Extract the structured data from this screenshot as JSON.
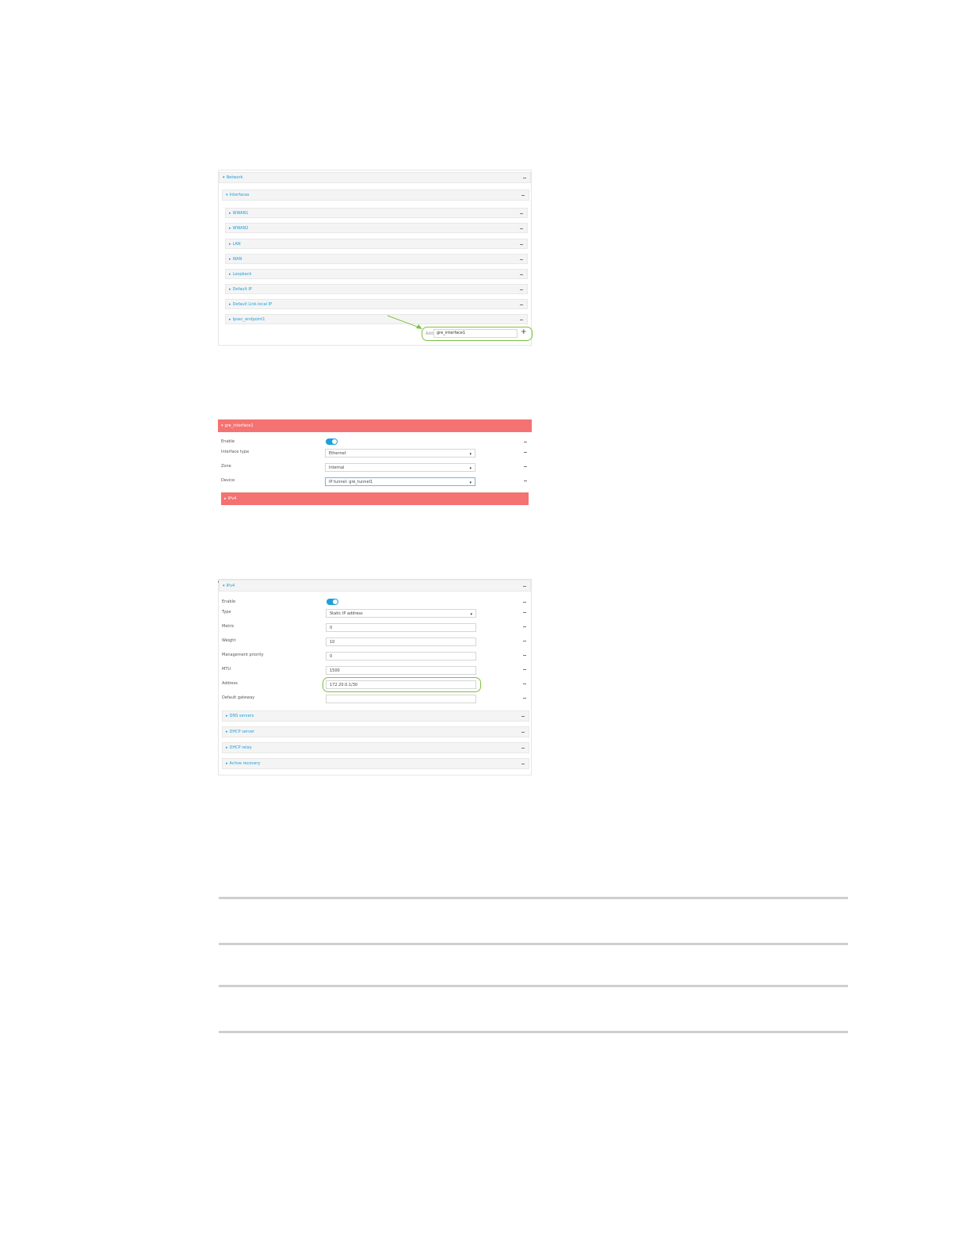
{
  "screenshot1": {
    "network_label": "Network",
    "interfaces_label": "Interfaces",
    "items": [
      "WWAN1",
      "WWAN2",
      "LAN",
      "WAN",
      "Loopback",
      "Default IP",
      "Default Link-local IP",
      "Ipsec_endpoint1"
    ],
    "add_label": "Add",
    "add_value": "gre_interface1",
    "add_icon": "plus-icon",
    "accent_color": "#1ea0d8",
    "highlight_color": "#7dc243"
  },
  "screenshot2": {
    "header": "gre_interface1",
    "enable_label": "Enable",
    "interface_type_label": "Interface type",
    "interface_type_value": "Ethernet",
    "zone_label": "Zone",
    "zone_value": "Internal",
    "device_label": "Device",
    "device_value": "IP tunnel: gre_tunnel1",
    "ipv4_label": "IPv4",
    "header_color": "#f57272"
  },
  "screenshot3": {
    "header": "IPv4",
    "fields": [
      {
        "label": "Enable",
        "value": ""
      },
      {
        "label": "Type",
        "value": "Static IP address"
      },
      {
        "label": "Metric",
        "value": "0"
      },
      {
        "label": "Weight",
        "value": "10"
      },
      {
        "label": "Management priority",
        "value": "0"
      },
      {
        "label": "MTU",
        "value": "1500"
      },
      {
        "label": "Address",
        "value": "172.20.0.1/30"
      },
      {
        "label": "Default gateway",
        "value": ""
      }
    ],
    "sections": [
      "DNS servers",
      "DHCP server",
      "DHCP relay",
      "Active recovery"
    ]
  }
}
